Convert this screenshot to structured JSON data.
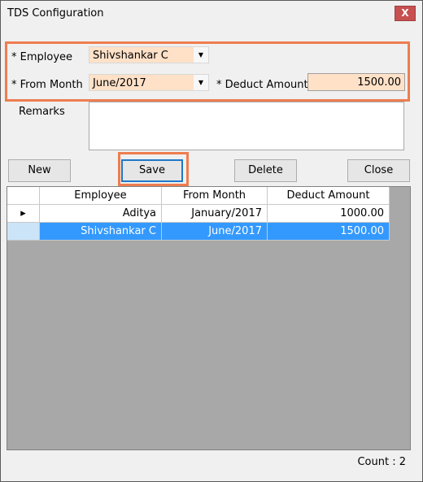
{
  "window": {
    "title": "TDS Configuration",
    "close_glyph": "X"
  },
  "form": {
    "employee_label": "* Employee",
    "employee_value": "Shivshankar C",
    "from_month_label": "* From Month",
    "from_month_value": "June/2017",
    "deduct_amount_label": "* Deduct Amount",
    "deduct_amount_value": "1500.00",
    "remarks_label": "Remarks",
    "remarks_value": ""
  },
  "buttons": {
    "new": "New",
    "save": "Save",
    "delete": "Delete",
    "close": "Close"
  },
  "grid": {
    "columns": [
      "Employee",
      "From Month",
      "Deduct Amount"
    ],
    "rows": [
      {
        "indicator": "▸",
        "employee": "Aditya",
        "from_month": "January/2017",
        "deduct_amount": "1000.00"
      },
      {
        "indicator": "",
        "employee": "Shivshankar C",
        "from_month": "June/2017",
        "deduct_amount": "1500.00"
      }
    ]
  },
  "footer": {
    "count": "Count : 2"
  },
  "colors": {
    "highlight": "#ee7d4f",
    "selection": "#3399ff",
    "required_field_bg": "#ffe1c8"
  },
  "icons": {
    "dropdown": "chevron-down-icon",
    "row_indicator": "caret-right-icon"
  }
}
